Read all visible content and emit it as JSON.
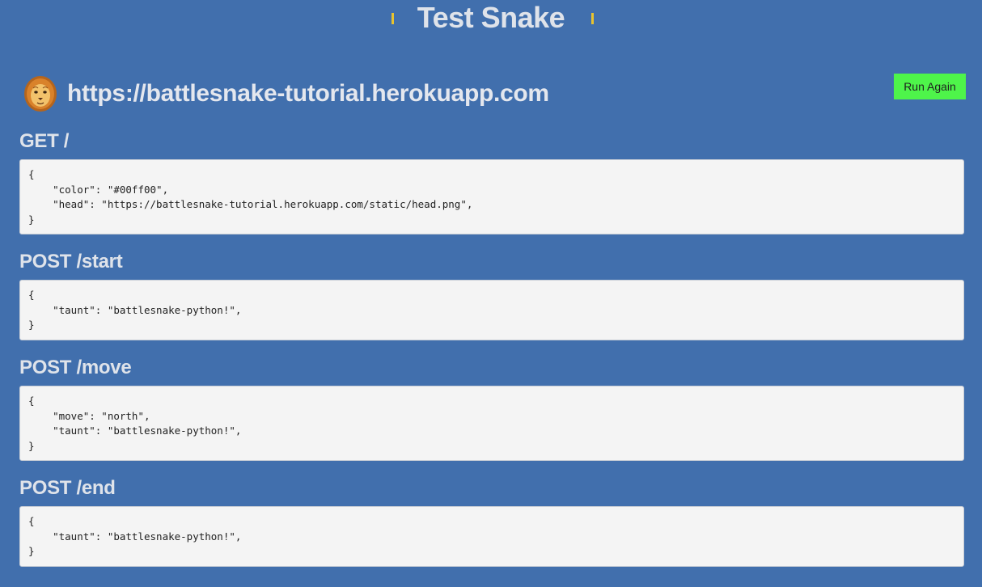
{
  "header": {
    "title": "Test Snake"
  },
  "snake": {
    "url": "https://battlesnake-tutorial.herokuapp.com",
    "avatar_icon": "lion-avatar-icon"
  },
  "actions": {
    "run_again_label": "Run Again",
    "run_again_color": "#4ef44a"
  },
  "colors": {
    "background": "#416fad",
    "code_background": "#f4f4f4",
    "title_tick": "#e8c32e"
  },
  "sections": [
    {
      "heading": "GET /",
      "body": "{\n    \"color\": \"#00ff00\",\n    \"head\": \"https://battlesnake-tutorial.herokuapp.com/static/head.png\",\n}"
    },
    {
      "heading": "POST /start",
      "body": "{\n    \"taunt\": \"battlesnake-python!\",\n}"
    },
    {
      "heading": "POST /move",
      "body": "{\n    \"move\": \"north\",\n    \"taunt\": \"battlesnake-python!\",\n}"
    },
    {
      "heading": "POST /end",
      "body": "{\n    \"taunt\": \"battlesnake-python!\",\n}"
    }
  ]
}
